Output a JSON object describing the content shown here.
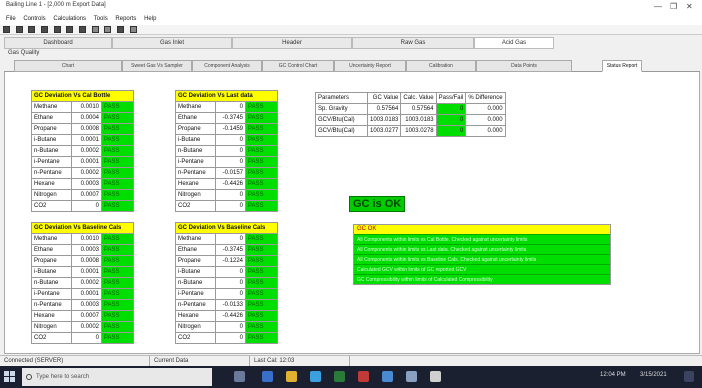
{
  "window": {
    "title": "Bailing Line 1 - [2,000 m Export Data]",
    "controls": [
      "—",
      "❐",
      "✕"
    ]
  },
  "menu": [
    "File",
    "Controls",
    "Calculations",
    "Tools",
    "Reports",
    "Help"
  ],
  "top_tabs": [
    "Dashboard",
    "Gas Inlet",
    "Header",
    "Raw Gas",
    "Acid Gas"
  ],
  "sub_label": "Gas Quality",
  "sub_tabs": [
    "Chart",
    "Sweet Gas Vs Sampler",
    "Component Analysis",
    "GC Control Chart",
    "Uncertainty Report",
    "Calibration",
    "Data Points",
    "Status Report"
  ],
  "tables": [
    {
      "header": "GC Deviation Vs Cal Bottle",
      "rows": [
        {
          "name": "Methane",
          "value": "0.0010",
          "status": "PASS"
        },
        {
          "name": "Ethane",
          "value": "0.0004",
          "status": "PASS"
        },
        {
          "name": "Propane",
          "value": "0.0008",
          "status": "PASS"
        },
        {
          "name": "i-Butane",
          "value": "0.0001",
          "status": "PASS"
        },
        {
          "name": "n-Butane",
          "value": "0.0002",
          "status": "PASS"
        },
        {
          "name": "i-Pentane",
          "value": "0.0001",
          "status": "PASS"
        },
        {
          "name": "n-Pentane",
          "value": "0.0002",
          "status": "PASS"
        },
        {
          "name": "Hexane",
          "value": "0.0003",
          "status": "PASS"
        },
        {
          "name": "Nitrogen",
          "value": "0.0007",
          "status": "PASS"
        },
        {
          "name": "CO2",
          "value": "0",
          "status": "PASS"
        }
      ]
    },
    {
      "header": "GC Deviation Vs Last data",
      "rows": [
        {
          "name": "Methane",
          "value": "0",
          "status": "PASS"
        },
        {
          "name": "Ethane",
          "value": "-0.3745",
          "status": "PASS"
        },
        {
          "name": "Propane",
          "value": "-0.1459",
          "status": "PASS"
        },
        {
          "name": "i-Butane",
          "value": "0",
          "status": "PASS"
        },
        {
          "name": "n-Butane",
          "value": "0",
          "status": "PASS"
        },
        {
          "name": "i-Pentane",
          "value": "0",
          "status": "PASS"
        },
        {
          "name": "n-Pentane",
          "value": "-0.0157",
          "status": "PASS"
        },
        {
          "name": "Hexane",
          "value": "-0.4426",
          "status": "PASS"
        },
        {
          "name": "Nitrogen",
          "value": "0",
          "status": "PASS"
        },
        {
          "name": "CO2",
          "value": "0",
          "status": "PASS"
        }
      ]
    },
    {
      "header": "GC Deviation Vs Baseline Cals",
      "rows": [
        {
          "name": "Methane",
          "value": "0.0010",
          "status": "PASS"
        },
        {
          "name": "Ethane",
          "value": "0.0003",
          "status": "PASS"
        },
        {
          "name": "Propane",
          "value": "0.0008",
          "status": "PASS"
        },
        {
          "name": "i-Butane",
          "value": "0.0001",
          "status": "PASS"
        },
        {
          "name": "n-Butane",
          "value": "0.0002",
          "status": "PASS"
        },
        {
          "name": "i-Pentane",
          "value": "0.0001",
          "status": "PASS"
        },
        {
          "name": "n-Pentane",
          "value": "0.0003",
          "status": "PASS"
        },
        {
          "name": "Hexane",
          "value": "0.0007",
          "status": "PASS"
        },
        {
          "name": "Nitrogen",
          "value": "0.0002",
          "status": "PASS"
        },
        {
          "name": "CO2",
          "value": "0",
          "status": "PASS"
        }
      ]
    },
    {
      "header": "GC Deviation Vs Baseline Cals",
      "rows": [
        {
          "name": "Methane",
          "value": "0",
          "status": "PASS"
        },
        {
          "name": "Ethane",
          "value": "-0.3745",
          "status": "PASS"
        },
        {
          "name": "Propane",
          "value": "-0.1224",
          "status": "PASS"
        },
        {
          "name": "i-Butane",
          "value": "0",
          "status": "PASS"
        },
        {
          "name": "n-Butane",
          "value": "0",
          "status": "PASS"
        },
        {
          "name": "i-Pentane",
          "value": "0",
          "status": "PASS"
        },
        {
          "name": "n-Pentane",
          "value": "-0.0133",
          "status": "PASS"
        },
        {
          "name": "Hexane",
          "value": "-0.4426",
          "status": "PASS"
        },
        {
          "name": "Nitrogen",
          "value": "0",
          "status": "PASS"
        },
        {
          "name": "CO2",
          "value": "0",
          "status": "PASS"
        }
      ]
    }
  ],
  "params": {
    "headers": [
      "Parameters",
      "GC Value",
      "Calc. Value",
      "Pass/Fail",
      "% Difference"
    ],
    "rows": [
      {
        "label": "Sp. Gravity",
        "gc": "0.57564",
        "calc": "0.57564",
        "pf": "0",
        "diff": "0.000"
      },
      {
        "label": "GCV/Btu(Cal)",
        "gc": "1003.0183",
        "calc": "1003.0183",
        "pf": "0",
        "diff": "0.000"
      },
      {
        "label": "GCV/Btu(Cal)",
        "gc": "1003.0277",
        "calc": "1003.0278",
        "pf": "0",
        "diff": "0.000"
      }
    ]
  },
  "gc_status": "GC is OK",
  "messages": {
    "header": "GC OK",
    "rows": [
      "All Components within limits vs Cal Bottle. Checked against uncertainty limits",
      "All Components within limits vs Last data. Checked against uncertainty limits",
      "All Components within limits vs Baseline Cals. Checked against uncertainty limits",
      "Calculated GCV within limits of GC reported GCV",
      "GC Compressibility within limits of Calculated Compressibility"
    ]
  },
  "status_bar": [
    "Connected (SERVER)",
    "Current Data",
    "Last Cal: 12:03"
  ],
  "taskbar": {
    "search_placeholder": "Type here to search",
    "time": "12:04 PM",
    "date": "3/15/2021"
  },
  "colors": {
    "pass": "#00dd00",
    "header": "#ffff00",
    "taskbar": "#1b2030"
  }
}
